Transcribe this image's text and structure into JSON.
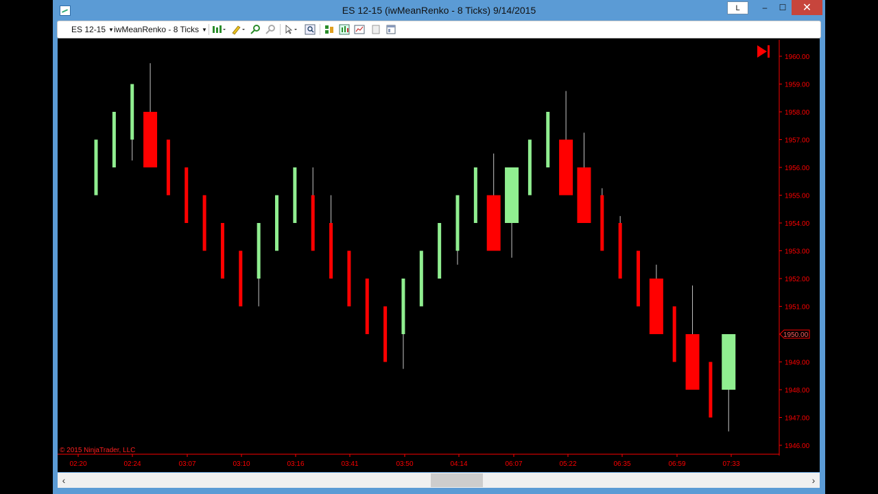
{
  "window": {
    "title": "ES 12-15 (iwMeanRenko - 8 Ticks)  9/14/2015",
    "l_button": "L",
    "minimize": "‒",
    "maximize": "☐",
    "close": "✕"
  },
  "toolbar": {
    "instrument": "ES 12-15",
    "bar_type": "iwMeanRenko - 8 Ticks"
  },
  "chart": {
    "copyright": "© 2015 NinjaTrader, LLC",
    "last_price_label": "1950.00",
    "colors": {
      "up": "#90ee90",
      "down": "#ff0000",
      "axis": "#ff0000",
      "background": "#000000"
    },
    "playback_icon": "skip-to-end-icon"
  },
  "chart_data": {
    "type": "candlestick",
    "ylim": [
      1945.75,
      1960.25
    ],
    "y_ticks": [
      "1960.00",
      "1959.00",
      "1958.00",
      "1957.00",
      "1956.00",
      "1955.00",
      "1954.00",
      "1953.00",
      "1952.00",
      "1951.00",
      "1950.00",
      "1949.00",
      "1948.00",
      "1947.00",
      "1946.00"
    ],
    "x_ticks": [
      "02:20",
      "02:24",
      "03:07",
      "03:10",
      "03:16",
      "03:41",
      "03:50",
      "04:14",
      "06:07",
      "05:22",
      "06:35",
      "06:59",
      "07:33"
    ],
    "bars": [
      {
        "o": 1955,
        "h": 1957,
        "l": 1955,
        "c": 1957
      },
      {
        "o": 1956,
        "h": 1958,
        "l": 1956,
        "c": 1958
      },
      {
        "o": 1957,
        "h": 1959,
        "l": 1956.25,
        "c": 1959
      },
      {
        "o": 1958,
        "h": 1959.75,
        "l": 1956,
        "c": 1956
      },
      {
        "o": 1957,
        "h": 1957,
        "l": 1955,
        "c": 1955
      },
      {
        "o": 1956,
        "h": 1956,
        "l": 1954,
        "c": 1954
      },
      {
        "o": 1955,
        "h": 1955,
        "l": 1953,
        "c": 1953
      },
      {
        "o": 1954,
        "h": 1954,
        "l": 1952,
        "c": 1952
      },
      {
        "o": 1953,
        "h": 1953,
        "l": 1951,
        "c": 1951
      },
      {
        "o": 1952,
        "h": 1954,
        "l": 1951,
        "c": 1954
      },
      {
        "o": 1953,
        "h": 1955,
        "l": 1953,
        "c": 1955
      },
      {
        "o": 1954,
        "h": 1956,
        "l": 1954,
        "c": 1956
      },
      {
        "o": 1955,
        "h": 1956,
        "l": 1953,
        "c": 1953
      },
      {
        "o": 1954,
        "h": 1955,
        "l": 1952,
        "c": 1952
      },
      {
        "o": 1953,
        "h": 1953,
        "l": 1951,
        "c": 1951
      },
      {
        "o": 1952,
        "h": 1952,
        "l": 1950,
        "c": 1950
      },
      {
        "o": 1951,
        "h": 1951,
        "l": 1949,
        "c": 1949
      },
      {
        "o": 1950,
        "h": 1952,
        "l": 1948.75,
        "c": 1952
      },
      {
        "o": 1951,
        "h": 1953,
        "l": 1951,
        "c": 1953
      },
      {
        "o": 1952,
        "h": 1954,
        "l": 1952,
        "c": 1954
      },
      {
        "o": 1953,
        "h": 1955,
        "l": 1952.5,
        "c": 1955
      },
      {
        "o": 1954,
        "h": 1956,
        "l": 1954,
        "c": 1956
      },
      {
        "o": 1955,
        "h": 1956.5,
        "l": 1953,
        "c": 1953
      },
      {
        "o": 1954,
        "h": 1956,
        "l": 1952.75,
        "c": 1956
      },
      {
        "o": 1955,
        "h": 1957,
        "l": 1955,
        "c": 1957
      },
      {
        "o": 1956,
        "h": 1958,
        "l": 1956,
        "c": 1958
      },
      {
        "o": 1957,
        "h": 1958.75,
        "l": 1955,
        "c": 1955
      },
      {
        "o": 1956,
        "h": 1957.25,
        "l": 1954,
        "c": 1954
      },
      {
        "o": 1955,
        "h": 1955.25,
        "l": 1953,
        "c": 1953
      },
      {
        "o": 1954,
        "h": 1954.25,
        "l": 1952,
        "c": 1952
      },
      {
        "o": 1953,
        "h": 1953,
        "l": 1951,
        "c": 1951
      },
      {
        "o": 1952,
        "h": 1952.5,
        "l": 1950,
        "c": 1950
      },
      {
        "o": 1951,
        "h": 1951,
        "l": 1949,
        "c": 1949
      },
      {
        "o": 1950,
        "h": 1951.75,
        "l": 1948,
        "c": 1948
      },
      {
        "o": 1949,
        "h": 1949,
        "l": 1947,
        "c": 1947
      },
      {
        "o": 1948,
        "h": 1950,
        "l": 1946.5,
        "c": 1950
      }
    ]
  }
}
